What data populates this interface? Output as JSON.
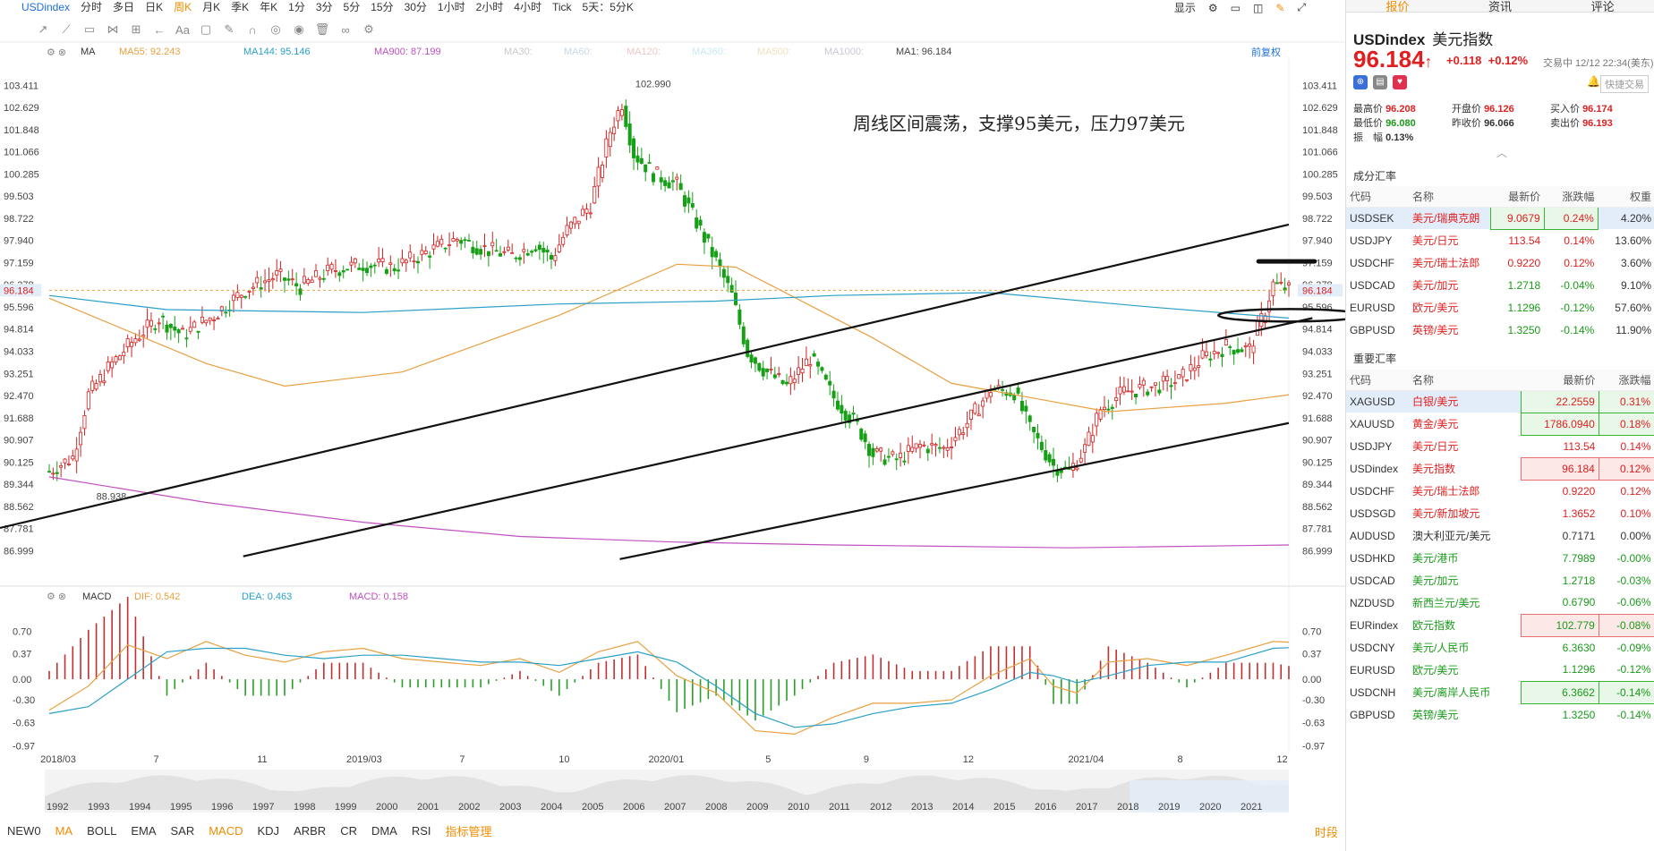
{
  "top": {
    "symbol": "USDindex",
    "periods": [
      "分时",
      "多日",
      "日K",
      "周K",
      "月K",
      "季K",
      "年K",
      "1分",
      "3分",
      "5分",
      "15分",
      "30分",
      "1小时",
      "2小时",
      "4小时",
      "Tick",
      "5天：5分K"
    ],
    "active_period": "周K",
    "display_label": "显示"
  },
  "candle_header": {
    "indicator": "MA",
    "ma55": "MA55: 92.243",
    "ma144": "MA144: 95.146",
    "ma900": "MA900: 87.199",
    "ma30": "MA30:",
    "ma60": "MA60:",
    "ma120": "MA120:",
    "ma360": "MA360:",
    "ma500": "MA500:",
    "ma1000": "MA1000:",
    "ma1": "MA1: 96.184",
    "fq": "前复权"
  },
  "chart_data": [
    {
      "type": "candlestick",
      "title": "周线区间震荡，支撑95美元，压力97美元",
      "y_ticks": [
        "103.411",
        "102.629",
        "101.848",
        "101.066",
        "100.285",
        "99.503",
        "98.722",
        "97.940",
        "97.159",
        "96.378",
        "95.596",
        "94.814",
        "94.033",
        "93.251",
        "92.470",
        "91.688",
        "90.907",
        "90.125",
        "89.344",
        "88.562",
        "87.781",
        "86.999"
      ],
      "ylim": [
        86.6,
        103.8
      ],
      "x_ticks": [
        "2018/03",
        "7",
        "11",
        "2019/03",
        "7",
        "10",
        "2020/01",
        "5",
        "9",
        "12",
        "2021/04",
        "8",
        "12"
      ],
      "current_price": "96.184",
      "high_label": "102.990",
      "low_label": "88.938",
      "close_path": [
        [
          0,
          89.8
        ],
        [
          6,
          90.3
        ],
        [
          10,
          92.5
        ],
        [
          16,
          93.6
        ],
        [
          22,
          94.5
        ],
        [
          28,
          95.2
        ],
        [
          34,
          94.6
        ],
        [
          42,
          95.3
        ],
        [
          50,
          96.2
        ],
        [
          58,
          96.7
        ],
        [
          64,
          96.3
        ],
        [
          72,
          96.9
        ],
        [
          80,
          97.1
        ],
        [
          88,
          97.0
        ],
        [
          96,
          97.5
        ],
        [
          104,
          98.0
        ],
        [
          112,
          97.6
        ],
        [
          118,
          97.4
        ],
        [
          124,
          97.8
        ],
        [
          128,
          97.3
        ],
        [
          132,
          98.3
        ],
        [
          138,
          99.2
        ],
        [
          143,
          101.8
        ],
        [
          146,
          102.8
        ],
        [
          149,
          101.0
        ],
        [
          154,
          100.3
        ],
        [
          160,
          99.9
        ],
        [
          166,
          98.3
        ],
        [
          170,
          97.2
        ],
        [
          174,
          96.0
        ],
        [
          178,
          94.0
        ],
        [
          182,
          93.4
        ],
        [
          188,
          92.8
        ],
        [
          194,
          93.8
        ],
        [
          200,
          92.4
        ],
        [
          206,
          91.4
        ],
        [
          210,
          90.4
        ],
        [
          216,
          90.2
        ],
        [
          222,
          90.7
        ],
        [
          228,
          90.6
        ],
        [
          234,
          91.5
        ],
        [
          240,
          92.7
        ],
        [
          246,
          92.6
        ],
        [
          250,
          91.3
        ],
        [
          256,
          90.0
        ],
        [
          260,
          89.8
        ],
        [
          264,
          90.6
        ],
        [
          268,
          92.0
        ],
        [
          274,
          92.6
        ],
        [
          282,
          92.8
        ],
        [
          288,
          93.0
        ],
        [
          294,
          93.8
        ],
        [
          300,
          94.2
        ],
        [
          306,
          94.1
        ],
        [
          310,
          95.5
        ],
        [
          312,
          96.4
        ],
        [
          316,
          96.2
        ]
      ],
      "ma55_path": [
        [
          0,
          95.9
        ],
        [
          40,
          93.6
        ],
        [
          60,
          92.8
        ],
        [
          90,
          93.3
        ],
        [
          130,
          95.3
        ],
        [
          160,
          97.1
        ],
        [
          175,
          97.0
        ],
        [
          210,
          94.5
        ],
        [
          230,
          92.9
        ],
        [
          250,
          92.4
        ],
        [
          270,
          91.9
        ],
        [
          300,
          92.2
        ],
        [
          316,
          92.5
        ]
      ],
      "ma144_path": [
        [
          0,
          96.0
        ],
        [
          30,
          95.5
        ],
        [
          80,
          95.4
        ],
        [
          130,
          95.7
        ],
        [
          170,
          95.8
        ],
        [
          200,
          96.0
        ],
        [
          240,
          96.1
        ],
        [
          280,
          95.6
        ],
        [
          316,
          95.2
        ]
      ],
      "ma900_path": [
        [
          0,
          89.6
        ],
        [
          40,
          88.7
        ],
        [
          80,
          88.0
        ],
        [
          120,
          87.5
        ],
        [
          160,
          87.3
        ],
        [
          200,
          87.2
        ],
        [
          260,
          87.1
        ],
        [
          316,
          87.2
        ]
      ],
      "channel_lines": [
        {
          "from": [
            0,
            87.8
          ],
          "to": [
            316,
            98.5
          ]
        },
        {
          "from": [
            62,
            86.8
          ],
          "to": [
            322,
            95.2
          ]
        },
        {
          "from": [
            158,
            86.7
          ],
          "to": [
            316,
            91.5
          ]
        }
      ],
      "annotations": [
        {
          "shape": "line",
          "at": [
            306,
            97.2
          ],
          "to": [
            318,
            97.2
          ]
        },
        {
          "shape": "ellipse",
          "center": [
            314,
            95.3
          ]
        }
      ]
    },
    {
      "type": "macd",
      "header_label": "MACD",
      "dif": "DIF: 0.542",
      "dea": "DEA: 0.463",
      "macd": "MACD: 0.158",
      "y_ticks": [
        "0.70",
        "0.37",
        "0.00",
        "-0.30",
        "-0.63",
        "-0.97"
      ],
      "ylim": [
        -0.99,
        0.9
      ],
      "dif_path": [
        [
          0,
          -0.45
        ],
        [
          10,
          -0.1
        ],
        [
          20,
          0.5
        ],
        [
          30,
          0.3
        ],
        [
          40,
          0.55
        ],
        [
          50,
          0.35
        ],
        [
          60,
          0.25
        ],
        [
          70,
          0.4
        ],
        [
          80,
          0.45
        ],
        [
          90,
          0.3
        ],
        [
          100,
          0.25
        ],
        [
          110,
          0.2
        ],
        [
          120,
          0.3
        ],
        [
          130,
          0.1
        ],
        [
          140,
          0.4
        ],
        [
          150,
          0.55
        ],
        [
          160,
          0.05
        ],
        [
          170,
          -0.2
        ],
        [
          180,
          -0.75
        ],
        [
          190,
          -0.8
        ],
        [
          200,
          -0.55
        ],
        [
          210,
          -0.35
        ],
        [
          220,
          -0.35
        ],
        [
          230,
          -0.3
        ],
        [
          240,
          0.05
        ],
        [
          250,
          0.3
        ],
        [
          256,
          -0.1
        ],
        [
          262,
          -0.2
        ],
        [
          270,
          0.25
        ],
        [
          280,
          0.3
        ],
        [
          290,
          0.2
        ],
        [
          300,
          0.35
        ],
        [
          306,
          0.45
        ],
        [
          312,
          0.55
        ],
        [
          316,
          0.54
        ]
      ],
      "dea_path": [
        [
          0,
          -0.5
        ],
        [
          10,
          -0.4
        ],
        [
          20,
          0.0
        ],
        [
          30,
          0.4
        ],
        [
          40,
          0.45
        ],
        [
          50,
          0.45
        ],
        [
          60,
          0.35
        ],
        [
          70,
          0.3
        ],
        [
          80,
          0.35
        ],
        [
          90,
          0.35
        ],
        [
          100,
          0.3
        ],
        [
          110,
          0.25
        ],
        [
          120,
          0.25
        ],
        [
          130,
          0.2
        ],
        [
          140,
          0.3
        ],
        [
          150,
          0.4
        ],
        [
          160,
          0.25
        ],
        [
          170,
          -0.1
        ],
        [
          180,
          -0.5
        ],
        [
          190,
          -0.7
        ],
        [
          200,
          -0.65
        ],
        [
          210,
          -0.5
        ],
        [
          220,
          -0.4
        ],
        [
          230,
          -0.35
        ],
        [
          240,
          -0.15
        ],
        [
          250,
          0.1
        ],
        [
          256,
          0.05
        ],
        [
          262,
          -0.05
        ],
        [
          270,
          0.05
        ],
        [
          280,
          0.2
        ],
        [
          290,
          0.25
        ],
        [
          300,
          0.25
        ],
        [
          306,
          0.35
        ],
        [
          312,
          0.45
        ],
        [
          316,
          0.46
        ]
      ]
    }
  ],
  "overview_years": [
    "1992",
    "1993",
    "1994",
    "1995",
    "1996",
    "1997",
    "1998",
    "1999",
    "2000",
    "2001",
    "2002",
    "2003",
    "2004",
    "2005",
    "2006",
    "2007",
    "2008",
    "2009",
    "2010",
    "2011",
    "2012",
    "2013",
    "2014",
    "2015",
    "2016",
    "2017",
    "2018",
    "2019",
    "2020",
    "2021"
  ],
  "bottom_tabs": [
    "NEW0",
    "MA",
    "BOLL",
    "EMA",
    "SAR",
    "MACD",
    "KDJ",
    "ARBR",
    "CR",
    "DMA",
    "RSI",
    "指标管理"
  ],
  "bottom_right": "时段",
  "right_panel": {
    "tabs": [
      "报价",
      "资讯",
      "评论"
    ],
    "active_tab": "报价",
    "code": "USDindex",
    "name": "美元指数",
    "price": "96.184",
    "change": "+0.118",
    "change_pct": "+0.12%",
    "trade_status": "交易中 12/12 22:34(美东)",
    "quick_trade": "快捷交易",
    "stats": [
      [
        {
          "k": "最高价",
          "v": "96.208"
        },
        {
          "k": "开盘价",
          "v": "96.126"
        },
        {
          "k": "买入价",
          "v": "96.174"
        }
      ],
      [
        {
          "k": "最低价",
          "v": "96.080",
          "g": true
        },
        {
          "k": "昨收价",
          "v": "96.066",
          "plain": true
        },
        {
          "k": "卖出价",
          "v": "96.193"
        }
      ],
      [
        {
          "k": "振　幅",
          "v": "0.13%",
          "plain": true
        }
      ]
    ],
    "section1": "成分汇率",
    "cols1": [
      "代码",
      "名称",
      "最新价",
      "涨跌幅",
      "权重"
    ],
    "comp": [
      {
        "code": "USDSEK",
        "name": "美元/瑞典克朗",
        "price": "9.0679",
        "chg": "0.24%",
        "w": "4.20%",
        "dir": "up"
      },
      {
        "code": "USDJPY",
        "name": "美元/日元",
        "price": "113.54",
        "chg": "0.14%",
        "w": "13.60%",
        "dir": "up"
      },
      {
        "code": "USDCHF",
        "name": "美元/瑞士法郎",
        "price": "0.9220",
        "chg": "0.12%",
        "w": "3.60%",
        "dir": "up"
      },
      {
        "code": "USDCAD",
        "name": "美元/加元",
        "price": "1.2718",
        "chg": "-0.04%",
        "w": "9.10%",
        "dir": "dn"
      },
      {
        "code": "EURUSD",
        "name": "欧元/美元",
        "price": "1.1296",
        "chg": "-0.12%",
        "w": "57.60%",
        "dir": "dn"
      },
      {
        "code": "GBPUSD",
        "name": "英镑/美元",
        "price": "1.3250",
        "chg": "-0.14%",
        "w": "11.90%",
        "dir": "dn"
      }
    ],
    "section2": "重要汇率",
    "cols2": [
      "代码",
      "名称",
      "最新价",
      "涨跌幅"
    ],
    "important": [
      {
        "code": "XAGUSD",
        "name": "白银/美元",
        "price": "22.2559",
        "chg": "0.31%",
        "dir": "up"
      },
      {
        "code": "XAUUSD",
        "name": "黄金/美元",
        "price": "1786.0940",
        "chg": "0.18%",
        "dir": "up"
      },
      {
        "code": "USDJPY",
        "name": "美元/日元",
        "price": "113.54",
        "chg": "0.14%",
        "dir": "up"
      },
      {
        "code": "USDindex",
        "name": "美元指数",
        "price": "96.184",
        "chg": "0.12%",
        "dir": "up"
      },
      {
        "code": "USDCHF",
        "name": "美元/瑞士法郎",
        "price": "0.9220",
        "chg": "0.12%",
        "dir": "up"
      },
      {
        "code": "USDSGD",
        "name": "美元/新加坡元",
        "price": "1.3652",
        "chg": "0.10%",
        "dir": "up"
      },
      {
        "code": "AUDUSD",
        "name": "澳大利亚元/美元",
        "price": "0.7171",
        "chg": "0.00%",
        "dir": "flat"
      },
      {
        "code": "USDHKD",
        "name": "美元/港币",
        "price": "7.7989",
        "chg": "-0.00%",
        "dir": "dn"
      },
      {
        "code": "USDCAD",
        "name": "美元/加元",
        "price": "1.2718",
        "chg": "-0.03%",
        "dir": "dn"
      },
      {
        "code": "NZDUSD",
        "name": "新西兰元/美元",
        "price": "0.6790",
        "chg": "-0.06%",
        "dir": "dn"
      },
      {
        "code": "EURindex",
        "name": "欧元指数",
        "price": "102.779",
        "chg": "-0.08%",
        "dir": "dn"
      },
      {
        "code": "USDCNY",
        "name": "美元/人民币",
        "price": "6.3630",
        "chg": "-0.09%",
        "dir": "dn"
      },
      {
        "code": "EURUSD",
        "name": "欧元/美元",
        "price": "1.1296",
        "chg": "-0.12%",
        "dir": "dn"
      },
      {
        "code": "USDCNH",
        "name": "美元/离岸人民币",
        "price": "6.3662",
        "chg": "-0.14%",
        "dir": "dn"
      },
      {
        "code": "GBPUSD",
        "name": "英镑/美元",
        "price": "1.3250",
        "chg": "-0.14%",
        "dir": "dn"
      }
    ]
  }
}
